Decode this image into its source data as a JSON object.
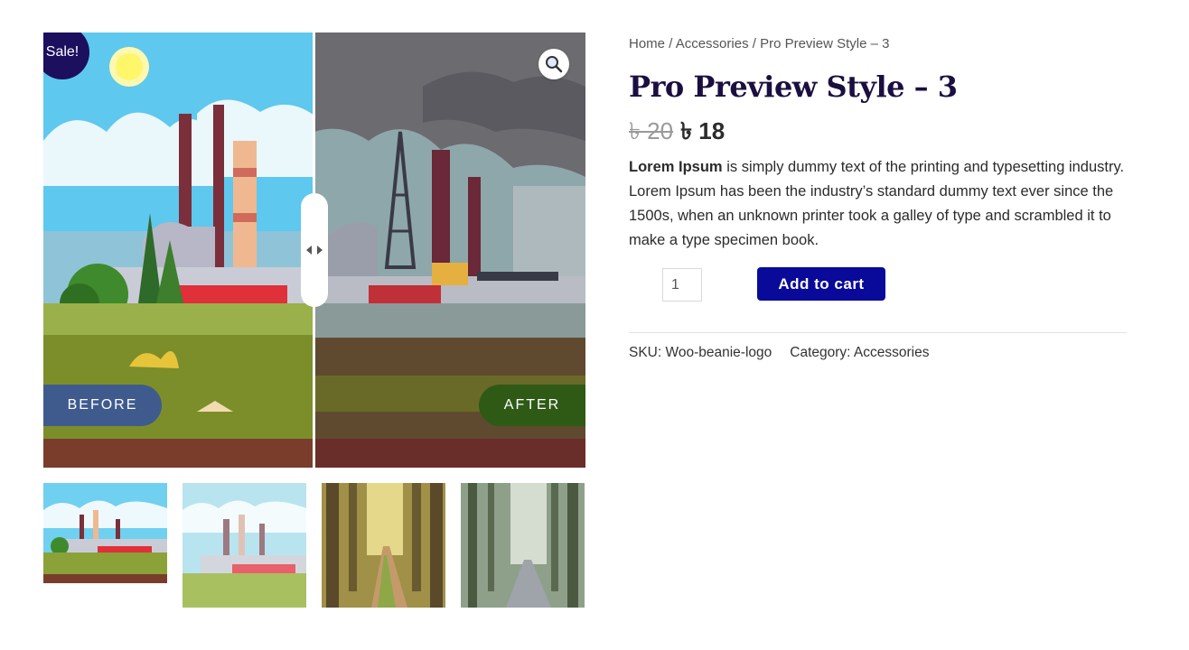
{
  "badge": {
    "sale": "Sale!"
  },
  "comparison": {
    "before_label": "BEFORE",
    "after_label": "AFTER"
  },
  "icons": {
    "zoom": "magnifier-icon",
    "handle": "left-right-arrows-icon"
  },
  "breadcrumb": {
    "home": "Home",
    "sep1": "/",
    "category": "Accessories",
    "sep2": "/",
    "current": "Pro Preview Style – 3"
  },
  "product": {
    "title": "Pro Preview Style – 3",
    "price_old": "৳ 20",
    "price_new": "৳ 18",
    "description_bold": "Lorem Ipsum",
    "description_rest": " is simply dummy text of the printing and typesetting industry. Lorem Ipsum has been the industry’s standard dummy text ever since the 1500s, when an unknown printer took a galley of type and scrambled it to make a type specimen book."
  },
  "cart": {
    "quantity": "1",
    "add_label": "Add to cart"
  },
  "meta": {
    "sku_label": "SKU:",
    "sku_value": "Woo-beanie-logo",
    "category_label": "Category:",
    "category_value": "Accessories"
  },
  "colors": {
    "accent": "#0a0a9a",
    "badge": "#1b0f5e",
    "title": "#1b0f40",
    "before": "#3f5b8e",
    "after": "#2e5a16"
  }
}
